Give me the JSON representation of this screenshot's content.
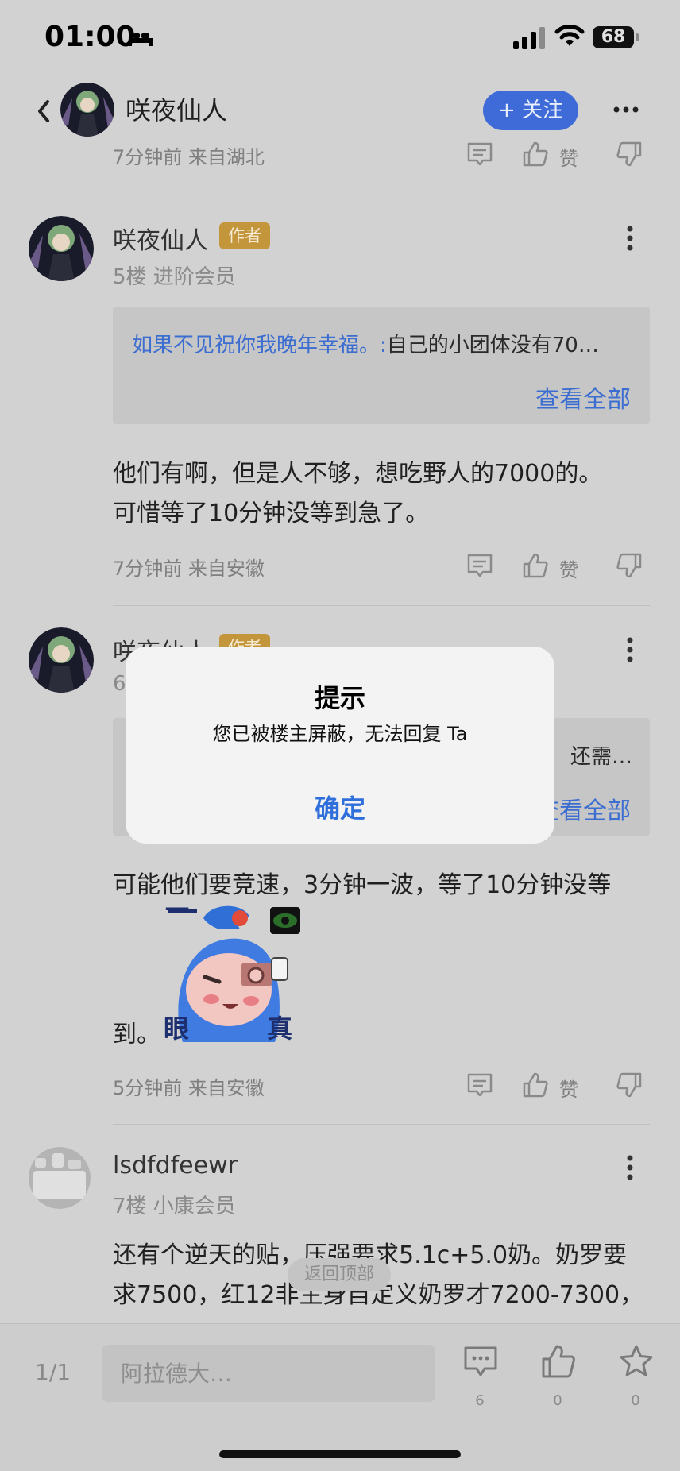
{
  "status_bar": {
    "time": "01:00",
    "battery": "68"
  },
  "header": {
    "name": "咲夜仙人",
    "follow_label": "+ 关注"
  },
  "first_reply_meta": {
    "time_location": "7分钟前 来自湖北",
    "like_label": "赞"
  },
  "replies": [
    {
      "name": "咲夜仙人",
      "badge": "作者",
      "floor": "5楼 进阶会员",
      "quote_author": "如果不见祝你我晚年幸福。:",
      "quote_text": "自己的小团体没有70…",
      "view_all": "查看全部",
      "body_lines": [
        "他们有啊，但是人不够，想吃野人的7000的。",
        "可惜等了10分钟没等到急了。"
      ],
      "time_location": "7分钟前 来自安徽",
      "like_label": "赞"
    },
    {
      "name": "咲夜仙人",
      "badge": "作者",
      "floor": "6",
      "quote_text": "还需…",
      "view_all": "查看全部",
      "body_lines": [
        "可能他们要竞速，3分钟一波，等了10分钟没等",
        "到。"
      ],
      "time_location": "5分钟前 来自安徽",
      "like_label": "赞"
    },
    {
      "name": "lsdfdfeewr",
      "floor": "7楼 小康会员",
      "body_lines": [
        "还有个逆天的贴，压强要求5.1c+5.0奶。奶罗要",
        "求7500，红12非主身自定义奶罗才7200-7300，"
      ]
    }
  ],
  "sticker": {
    "text_left": "一",
    "text_eye": "眼",
    "text_true": "真"
  },
  "back_to_top": "返回顶部",
  "bottom_bar": {
    "page": "1/1",
    "input_placeholder": "阿拉德大…",
    "comment_count": "6",
    "like_count": "0",
    "star_count": "0"
  },
  "dialog": {
    "title": "提示",
    "message": "您已被楼主屏蔽，无法回复 Ta",
    "ok_label": "确定"
  },
  "colors": {
    "accent": "#3f6bd8",
    "badge": "#c4963c",
    "dialog_button": "#2f6fdb",
    "overlay": "#d2d2d2"
  }
}
